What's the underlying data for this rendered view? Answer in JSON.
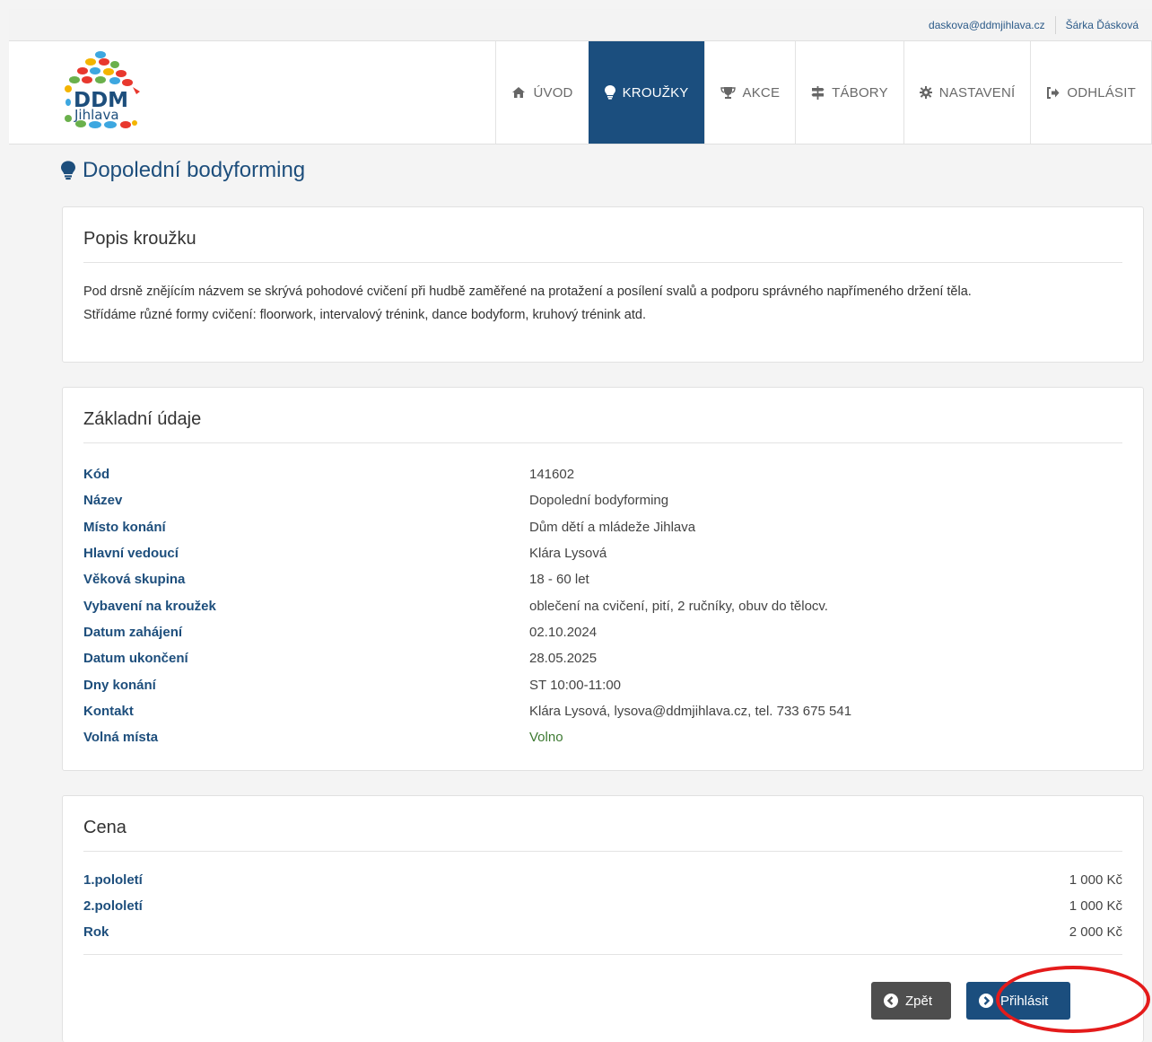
{
  "user": {
    "email": "daskova@ddmjihlava.cz",
    "name": "Šárka Ďásková"
  },
  "logo": {
    "line1": "DDM",
    "line2": "Jihlava"
  },
  "nav": [
    {
      "label": "ÚVOD",
      "icon": "home-icon"
    },
    {
      "label": "KROUŽKY",
      "icon": "lightbulb-icon",
      "active": true
    },
    {
      "label": "AKCE",
      "icon": "trophy-icon"
    },
    {
      "label": "TÁBORY",
      "icon": "signpost-icon"
    },
    {
      "label": "NASTAVENÍ",
      "icon": "gear-icon"
    },
    {
      "label": "ODHLÁSIT",
      "icon": "sign-out-icon"
    }
  ],
  "title": "Dopolední bodyforming",
  "description": {
    "heading": "Popis kroužku",
    "line1": "Pod drsně znějícím názvem se skrývá pohodové cvičení při hudbě zaměřené na protažení a posílení svalů a podporu správného napřímeného držení těla.",
    "line2": "Střídáme různé formy cvičení: floorwork, intervalový trénink, dance bodyform, kruhový trénink atd."
  },
  "details": {
    "heading": "Základní údaje",
    "rows": [
      {
        "label": "Kód",
        "value": "141602"
      },
      {
        "label": "Název",
        "value": "Dopolední bodyforming"
      },
      {
        "label": "Místo konání",
        "value": "Dům dětí a mládeže Jihlava"
      },
      {
        "label": "Hlavní vedoucí",
        "value": "Klára Lysová"
      },
      {
        "label": "Věková skupina",
        "value": "18 - 60 let"
      },
      {
        "label": "Vybavení na kroužek",
        "value": "oblečení na cvičení, pití, 2 ručníky, obuv do tělocv."
      },
      {
        "label": "Datum zahájení",
        "value": "02.10.2024"
      },
      {
        "label": "Datum ukončení",
        "value": "28.05.2025"
      },
      {
        "label": "Dny konání",
        "value": "ST 10:00-11:00"
      },
      {
        "label": "Kontakt",
        "value": "Klára Lysová, lysova@ddmjihlava.cz, tel. 733 675 541"
      },
      {
        "label": "Volná místa",
        "value": "Volno"
      }
    ]
  },
  "price": {
    "heading": "Cena",
    "rows": [
      {
        "label": "1.pololetí",
        "value": "1 000 Kč"
      },
      {
        "label": "2.pololetí",
        "value": "1 000 Kč"
      },
      {
        "label": "Rok",
        "value": "2 000 Kč"
      }
    ]
  },
  "buttons": {
    "back": "Zpět",
    "signup": "Přihlásit"
  },
  "colors": {
    "brand": "#1b4e7e",
    "free": "#3d7a32",
    "highlight": "#e41b1b"
  }
}
